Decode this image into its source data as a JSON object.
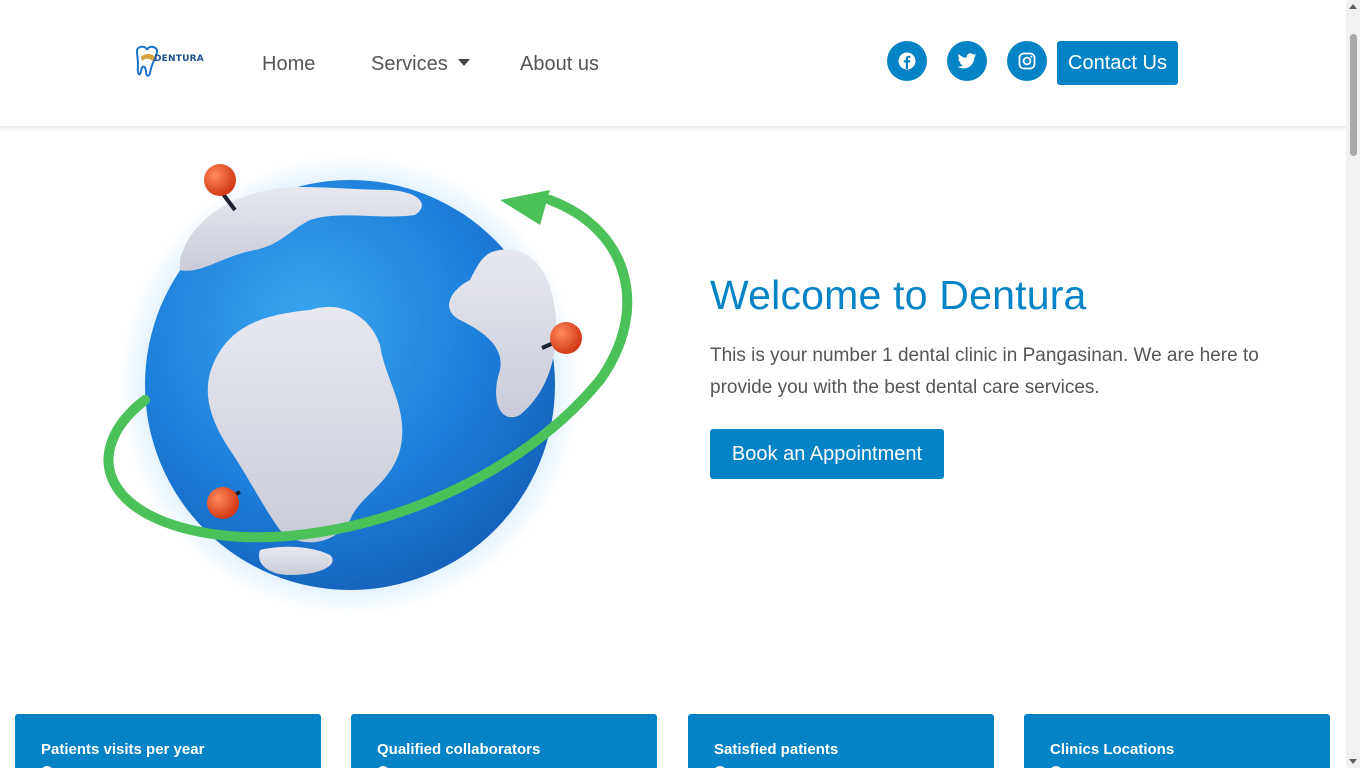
{
  "header": {
    "logo_text": "DENTURA",
    "nav": {
      "home": "Home",
      "services": "Services",
      "about": "About us"
    },
    "social_icons": [
      "facebook-icon",
      "twitter-icon",
      "instagram-icon"
    ],
    "contact_label": "Contact Us"
  },
  "hero": {
    "title": "Welcome to Dentura",
    "description": "This is your number 1 dental clinic in Pangasinan. We are here to provide you with the best dental care services.",
    "cta_label": "Book an Appointment"
  },
  "stats": [
    {
      "label": "Patients visits per year"
    },
    {
      "label": "Qualified collaborators"
    },
    {
      "label": "Satisfied patients"
    },
    {
      "label": "Clinics Locations"
    }
  ],
  "colors": {
    "primary": "#0583c7",
    "text": "#555555",
    "globe": "#1f84dc",
    "orbit": "#4cc15a",
    "pin": "#e8461f"
  },
  "page_load_progress": 0.2
}
